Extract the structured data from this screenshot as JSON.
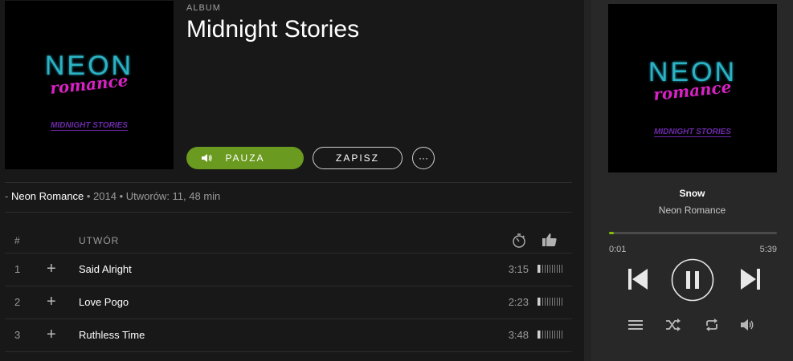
{
  "album": {
    "type_label": "ALBUM",
    "title": "Midnight Stories",
    "cover": {
      "band": "NEON",
      "script": "romance",
      "subtitle": "MIDNIGHT STORIES"
    }
  },
  "actions": {
    "play_label": "PAUZA",
    "save_label": "ZAPISZ",
    "more_label": "···"
  },
  "meta": {
    "prefix": "- ",
    "artist": "Neon Romance",
    "rest": " • 2014 • Utworów: 11, 48 min"
  },
  "table": {
    "col_num": "#",
    "col_track": "UTWÓR",
    "rows": [
      {
        "num": "1",
        "name": "Said Alright",
        "duration": "3:15",
        "popularity": 0.1
      },
      {
        "num": "2",
        "name": "Love Pogo",
        "duration": "2:23",
        "popularity": 0.1
      },
      {
        "num": "3",
        "name": "Ruthless Time",
        "duration": "3:48",
        "popularity": 0.1
      }
    ]
  },
  "now_playing": {
    "title": "Snow",
    "artist": "Neon Romance",
    "elapsed": "0:01",
    "total": "5:39",
    "progress": 0.03
  },
  "colors": {
    "accent": "#84bd00",
    "play_button": "#6a9a1f"
  },
  "icons": {
    "play_button": "speaker-icon",
    "duration_header": "stopwatch-icon",
    "popularity_header": "thumbs-up-icon",
    "add": "plus-icon",
    "prev": "skip-previous-icon",
    "pause": "pause-icon",
    "next": "skip-next-icon",
    "queue": "queue-icon",
    "shuffle": "shuffle-icon",
    "repeat": "repeat-icon",
    "volume": "volume-icon"
  }
}
